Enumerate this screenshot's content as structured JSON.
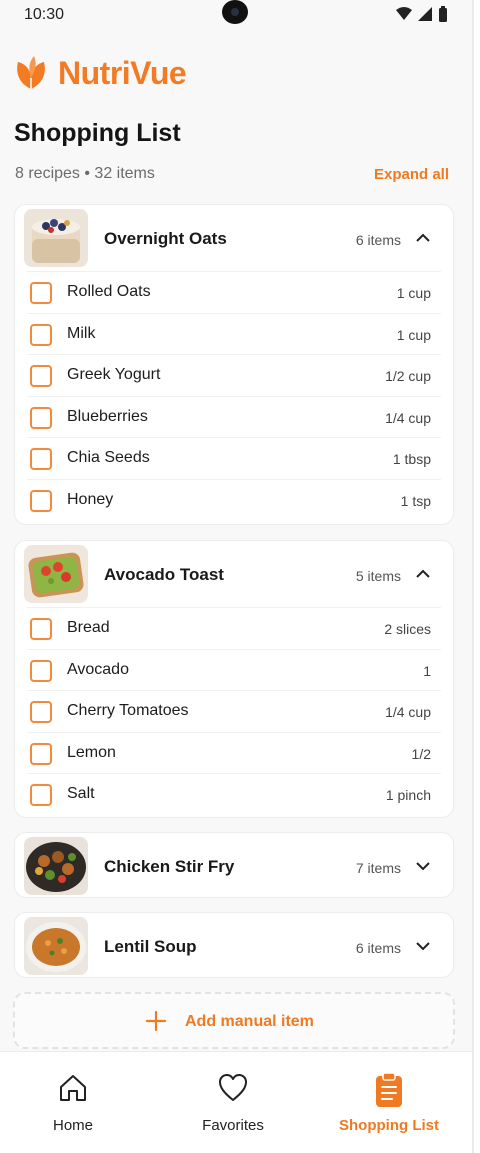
{
  "status_bar": {
    "time": "10:30"
  },
  "brand": {
    "name": "NutriVue",
    "accent": "#f27b23"
  },
  "page": {
    "title": "Shopping List",
    "summary": "8 recipes • 32 items",
    "expand_all": "Expand all"
  },
  "recipes": [
    {
      "name": "Overnight Oats",
      "count": "6 items",
      "expanded": true,
      "items": [
        {
          "name": "Rolled Oats",
          "qty": "1 cup",
          "checked": false
        },
        {
          "name": "Milk",
          "qty": "1 cup",
          "checked": false
        },
        {
          "name": "Greek Yogurt",
          "qty": "1/2 cup",
          "checked": false
        },
        {
          "name": "Blueberries",
          "qty": "1/4 cup",
          "checked": false
        },
        {
          "name": "Chia Seeds",
          "qty": "1 tbsp",
          "checked": false
        },
        {
          "name": "Honey",
          "qty": "1 tsp",
          "checked": false
        }
      ]
    },
    {
      "name": "Avocado Toast",
      "count": "5 items",
      "expanded": true,
      "items": [
        {
          "name": "Bread",
          "qty": "2 slices",
          "checked": false
        },
        {
          "name": "Avocado",
          "qty": "1",
          "checked": false
        },
        {
          "name": "Cherry Tomatoes",
          "qty": "1/4 cup",
          "checked": false
        },
        {
          "name": "Lemon",
          "qty": "1/2",
          "checked": false
        },
        {
          "name": "Salt",
          "qty": "1 pinch",
          "checked": false
        }
      ]
    },
    {
      "name": "Chicken Stir Fry",
      "count": "7 items",
      "expanded": false
    },
    {
      "name": "Lentil Soup",
      "count": "6 items",
      "expanded": false
    }
  ],
  "add_manual": "Add manual item",
  "nav": {
    "home": "Home",
    "favorites": "Favorites",
    "shopping_list": "Shopping List",
    "active": "shopping_list"
  }
}
